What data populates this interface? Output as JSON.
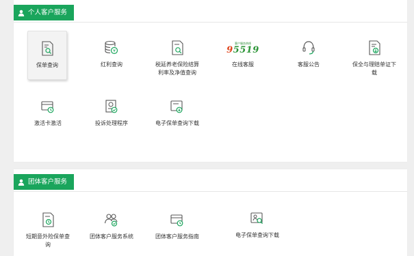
{
  "colors": {
    "accent": "#1aa55c",
    "icon": "#555555",
    "icon_accent": "#1aa55c",
    "logo_green": "#2b9436",
    "logo_red": "#e0441b"
  },
  "personal": {
    "title": "个人客户服务",
    "items": [
      {
        "label": "保单查询",
        "icon": "policy-search-icon",
        "selected": true
      },
      {
        "label": "红利查询",
        "icon": "coin-stack-icon"
      },
      {
        "label": "税延养老保险结算利率及净值查询",
        "icon": "document-magnifier-icon"
      },
      {
        "label": "在线客服",
        "icon": "hotline-logo",
        "logo_small": "客户服务热线",
        "logo_number": "95519"
      },
      {
        "label": "客服公告",
        "icon": "headset-icon"
      },
      {
        "label": "保全与理赔单证下载",
        "icon": "document-download-icon"
      },
      {
        "label": "激活卡激活",
        "icon": "card-activate-icon"
      },
      {
        "label": "投诉处理程序",
        "icon": "complaint-certificate-icon"
      },
      {
        "label": "电子保单查询下载",
        "icon": "e-policy-download-icon"
      }
    ]
  },
  "group": {
    "title": "团体客户服务",
    "items": [
      {
        "label": "短期意外险保单查询",
        "icon": "short-term-policy-icon"
      },
      {
        "label": "团体客户服务系统",
        "icon": "group-people-icon"
      },
      {
        "label": "团体客户服务指南",
        "icon": "service-guide-icon"
      },
      {
        "label": "电子保单查询下载",
        "icon": "e-policy-search-icon"
      }
    ]
  }
}
